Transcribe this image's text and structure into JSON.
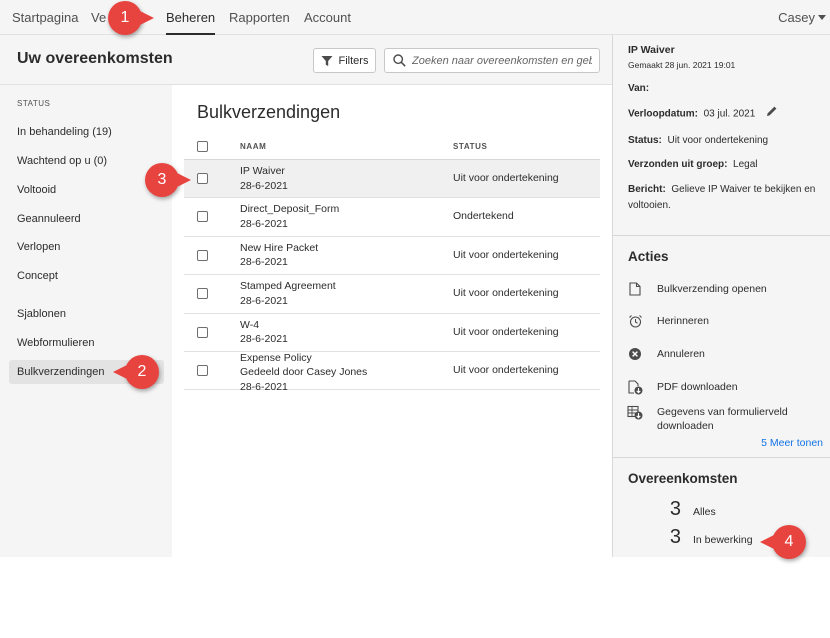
{
  "topnav": {
    "items": [
      "Startpagina",
      "Ve",
      "Beheren",
      "Rapporten",
      "Account"
    ],
    "active": "Beheren",
    "user": "Casey"
  },
  "header": {
    "title": "Uw overeenkomsten",
    "filters_label": "Filters",
    "search_placeholder": "Zoeken naar overeenkomsten en gebr..."
  },
  "sidebar": {
    "status_label": "STATUS",
    "items": [
      "In behandeling (19)",
      "Wachtend op u (0)",
      "Voltooid",
      "Geannuleerd",
      "Verlopen",
      "Concept",
      "Sjablonen",
      "Webformulieren",
      "Bulkverzendingen"
    ],
    "selected": "Bulkverzendingen"
  },
  "main": {
    "title": "Bulkverzendingen",
    "columns": {
      "name": "NAAM",
      "status": "STATUS"
    },
    "rows": [
      {
        "name": "IP Waiver",
        "sub": "",
        "date": "28-6-2021",
        "status": "Uit voor ondertekening"
      },
      {
        "name": "Direct_Deposit_Form",
        "sub": "",
        "date": "28-6-2021",
        "status": "Ondertekend"
      },
      {
        "name": "New Hire Packet",
        "sub": "",
        "date": "28-6-2021",
        "status": "Uit voor ondertekening"
      },
      {
        "name": "Stamped Agreement",
        "sub": "",
        "date": "28-6-2021",
        "status": "Uit voor ondertekening"
      },
      {
        "name": "W-4",
        "sub": "",
        "date": "28-6-2021",
        "status": "Uit voor ondertekening"
      },
      {
        "name": "Expense Policy",
        "sub": "Gedeeld door Casey Jones",
        "date": "28-6-2021",
        "status": "Uit voor ondertekening"
      }
    ]
  },
  "details": {
    "title": "IP Waiver",
    "created": "Gemaakt 28 jun. 2021 19:01",
    "from_label": "Van:",
    "expiry_label": "Verloopdatum:",
    "expiry_value": "03 jul. 2021",
    "status_label": "Status:",
    "status_value": "Uit voor ondertekening",
    "group_label": "Verzonden uit groep:",
    "group_value": "Legal",
    "message_label": "Bericht:",
    "message_value": "Gelieve IP Waiver te bekijken en voltooien."
  },
  "actions": {
    "heading": "Acties",
    "items": [
      {
        "label": "Bulkverzending openen",
        "icon": "document-icon"
      },
      {
        "label": "Herinneren",
        "icon": "alarm-clock-icon"
      },
      {
        "label": "Annuleren",
        "icon": "cancel-circle-icon"
      },
      {
        "label": "PDF downloaden",
        "icon": "pdf-download-icon"
      },
      {
        "label": "Gegevens van formulierveld downloaden",
        "icon": "form-data-download-icon"
      }
    ],
    "more": "5 Meer tonen"
  },
  "agreements": {
    "heading": "Overeenkomsten",
    "counts": [
      {
        "num": "3",
        "label": "Alles"
      },
      {
        "num": "3",
        "label": "In bewerking"
      }
    ]
  },
  "markers": [
    "1",
    "2",
    "3",
    "4"
  ],
  "colors": {
    "accent_link": "#1473e6",
    "marker": "#e8443f"
  }
}
